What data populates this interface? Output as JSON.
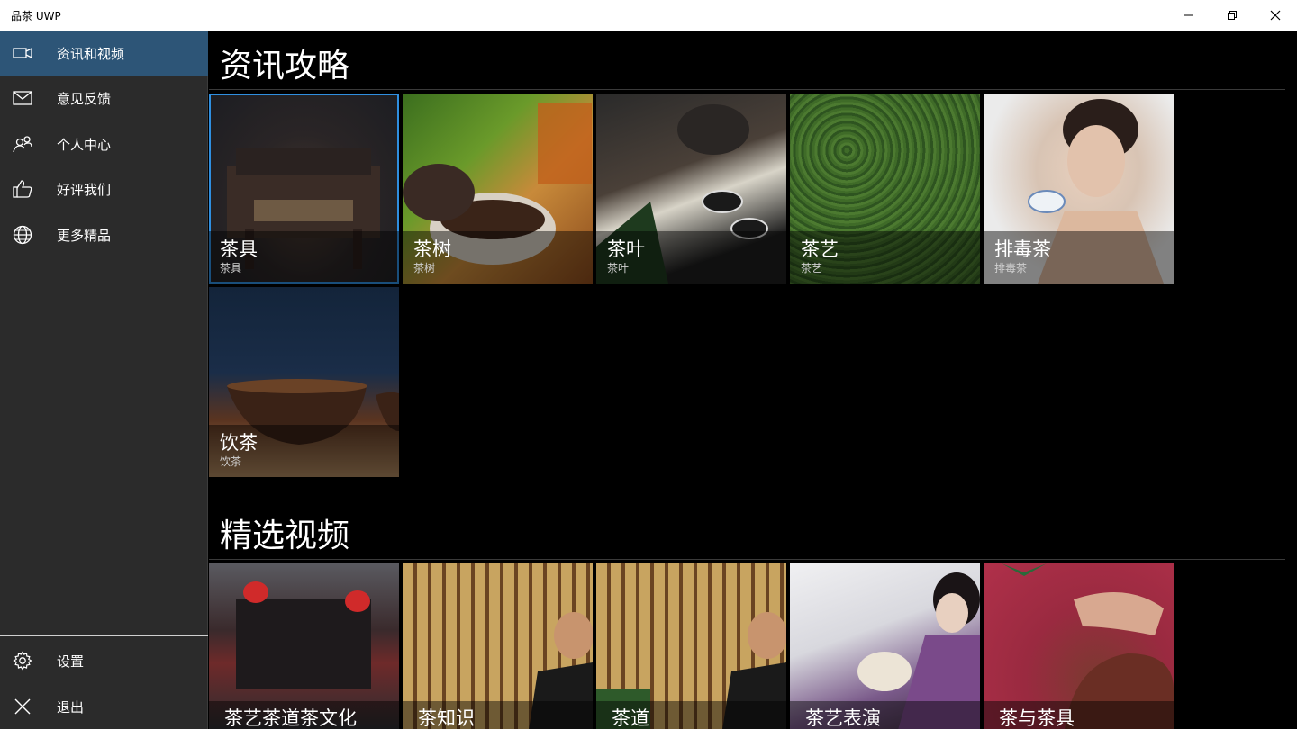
{
  "window": {
    "title": "品茶 UWP"
  },
  "sidebar": {
    "items": [
      {
        "label": "资讯和视频",
        "icon": "video-camera-icon"
      },
      {
        "label": "意见反馈",
        "icon": "mail-icon"
      },
      {
        "label": "个人中心",
        "icon": "people-icon"
      },
      {
        "label": "好评我们",
        "icon": "thumbs-up-icon"
      },
      {
        "label": "更多精品",
        "icon": "globe-icon"
      }
    ],
    "footer": [
      {
        "label": "设置",
        "icon": "gear-icon"
      },
      {
        "label": "退出",
        "icon": "close-icon"
      }
    ],
    "active_color": "#2d5577"
  },
  "main": {
    "articles": {
      "title": "资讯攻略",
      "tiles": [
        {
          "title": "茶具",
          "subtitle": "茶具"
        },
        {
          "title": "茶树",
          "subtitle": "茶树"
        },
        {
          "title": "茶叶",
          "subtitle": "茶叶"
        },
        {
          "title": "茶艺",
          "subtitle": "茶艺"
        },
        {
          "title": "排毒茶",
          "subtitle": "排毒茶"
        },
        {
          "title": "饮茶",
          "subtitle": "饮茶"
        }
      ]
    },
    "videos": {
      "title": "精选视频",
      "tiles": [
        {
          "title": "茶艺茶道茶文化"
        },
        {
          "title": "茶知识"
        },
        {
          "title": "茶道"
        },
        {
          "title": "茶艺表演"
        },
        {
          "title": "茶与茶具"
        }
      ]
    },
    "selection_color": "#2f8fe0"
  }
}
